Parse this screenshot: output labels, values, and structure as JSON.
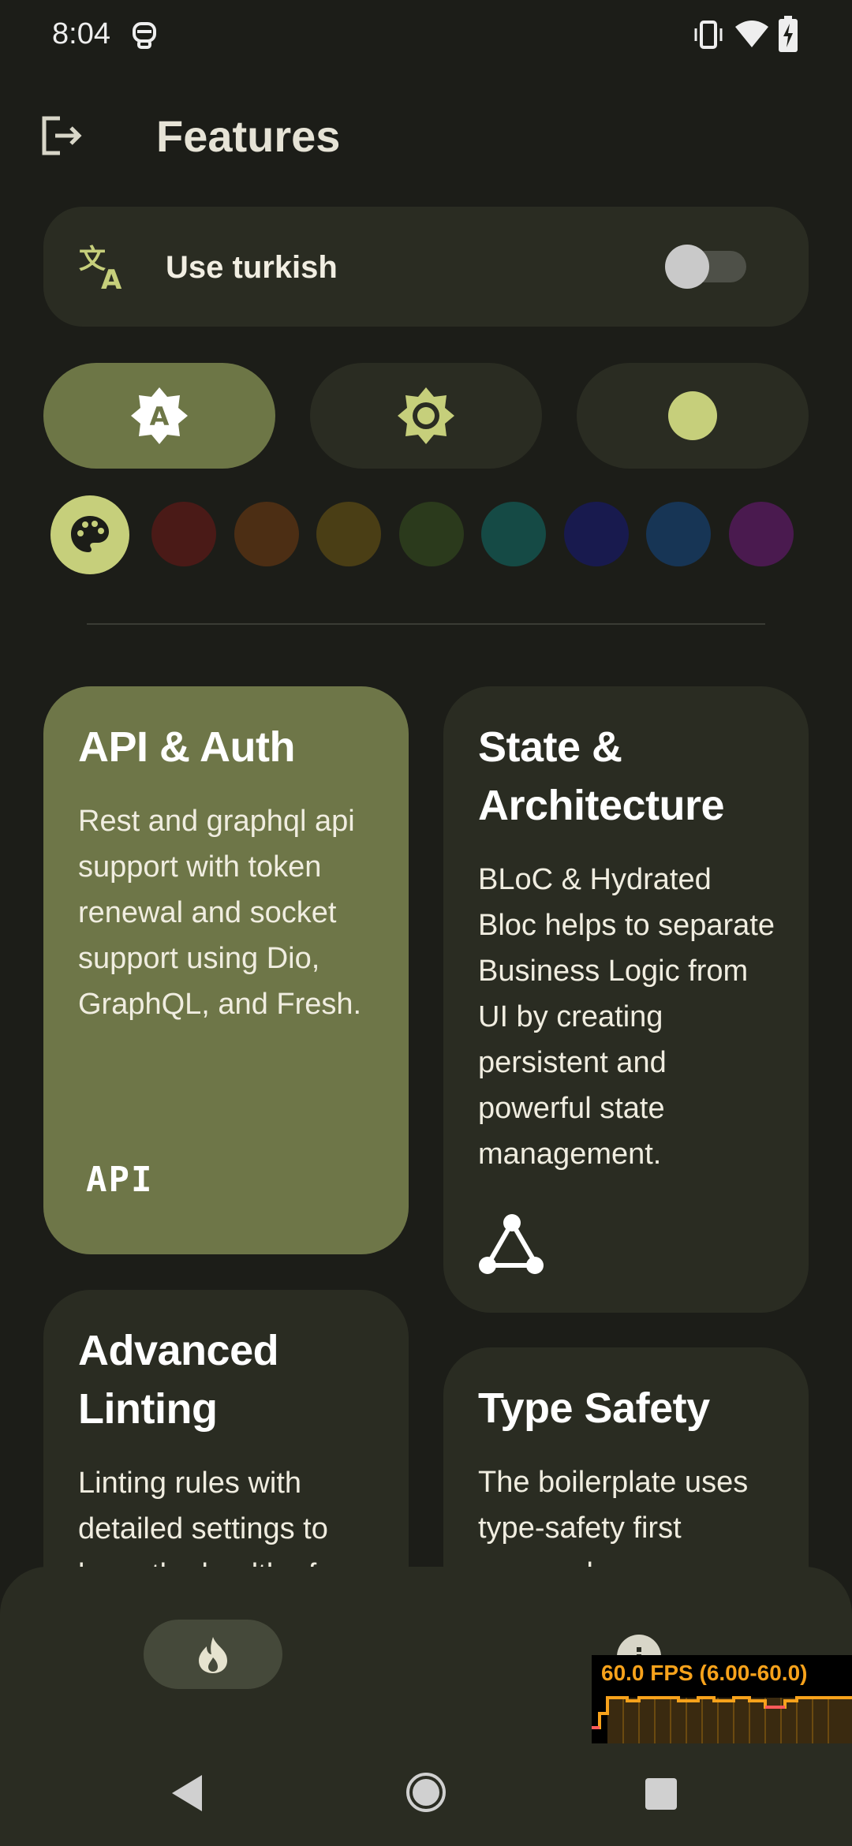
{
  "status_bar": {
    "time": "8:04"
  },
  "app_bar": {
    "title": "Features"
  },
  "language": {
    "label": "Use turkish",
    "enabled": false
  },
  "theme_modes": [
    {
      "id": "auto",
      "icon": "brightness-auto-icon",
      "selected": true
    },
    {
      "id": "light",
      "icon": "sun-icon",
      "selected": false
    },
    {
      "id": "dark",
      "icon": "moon-dot-icon",
      "selected": false
    }
  ],
  "palette": {
    "selected": "dynamic",
    "colors": [
      "#4a1a17",
      "#4c2e14",
      "#4a3e15",
      "#2b3a1c",
      "#154a45",
      "#181a4e",
      "#173555",
      "#4a1a4f"
    ]
  },
  "features": [
    {
      "title": "API & Auth",
      "description": "Rest and graphql api support with token renewal and socket support using Dio, GraphQL, and Fresh.",
      "icon_label": "API"
    },
    {
      "title": "State & Architecture",
      "description": "BLoC & Hydrated Bloc helps to separate Business Logic from UI by creating persistent and powerful state management.",
      "icon": "graph-icon"
    },
    {
      "title": "Advanced Linting",
      "description": "Linting rules with detailed settings to keep the health of"
    },
    {
      "title": "Type Safety",
      "description": "The boilerplate uses type-safety first approach"
    }
  ],
  "fps_overlay": {
    "text": "60.0 FPS (6.00-60.0)"
  },
  "colors": {
    "background": "#1c1d18",
    "surface": "#2a2c22",
    "accent": "#6e7648",
    "accent_light": "#c6cf7b",
    "fps": "#f7a21b"
  }
}
